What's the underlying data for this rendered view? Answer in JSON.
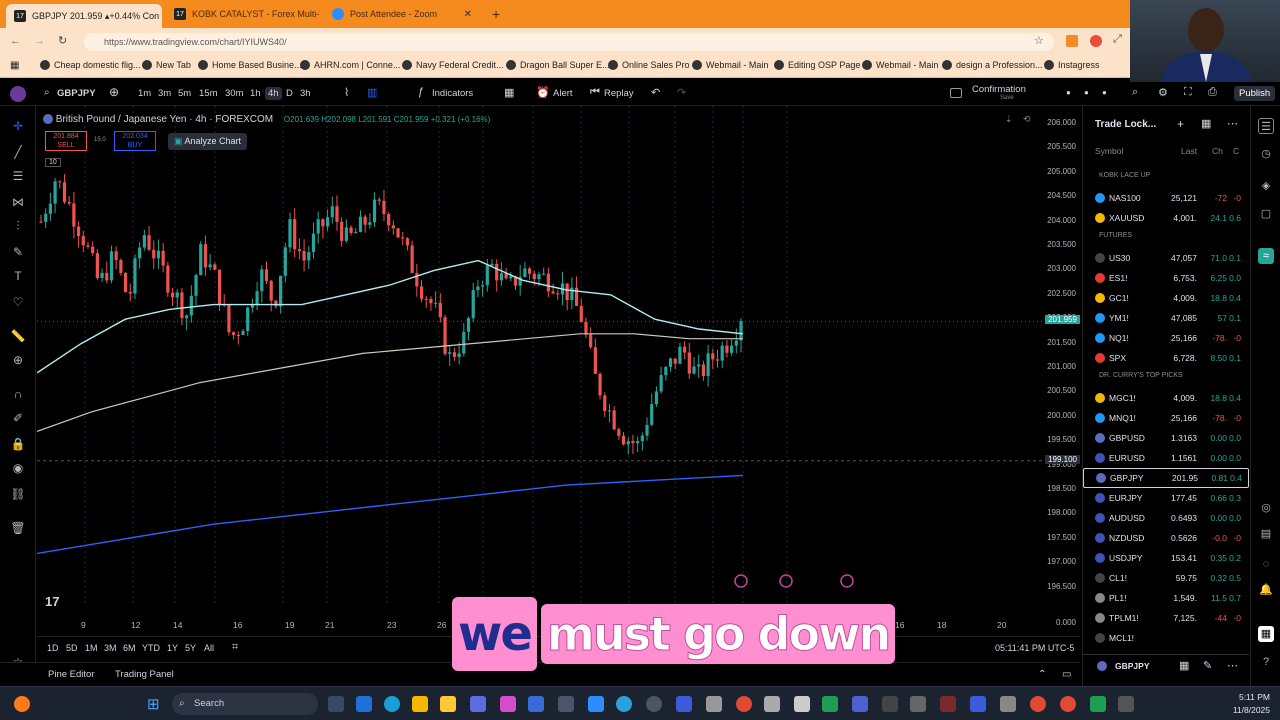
{
  "browser": {
    "tabs": [
      {
        "label": "GBPJPY 201.959 ▴+0.44% Con"
      },
      {
        "label": "KOBK CATALYST - Forex Multi-T"
      },
      {
        "label": "Post Attendee - Zoom"
      }
    ],
    "url": "https://www.tradingview.com/chart/IYIUWS40/",
    "bookmarks": [
      "Cheap domestic flig...",
      "New Tab",
      "Home Based Busine...",
      "AHRN.com | Conne...",
      "Navy Federal Credit...",
      "Dragon Ball Super E...",
      "Online Sales Pro",
      "Webmail - Main",
      "Editing OSP Page",
      "Webmail - Main",
      "design a Profession...",
      "Instagress"
    ]
  },
  "toolbar": {
    "symbol": "GBPJPY",
    "intervals": [
      "1m",
      "3m",
      "5m",
      "15m",
      "30m",
      "1h",
      "4h",
      "D",
      "3h"
    ],
    "indicators": "Indicators",
    "alert": "Alert",
    "replay": "Replay",
    "layout_name": "Confirmation",
    "layout_sub": "Save",
    "publish": "Publish"
  },
  "chart_header": {
    "title": "British Pound / Japanese Yen · 4h · FOREXCOM",
    "ohlc": "O201.639 H202.098 L201.591 C201.959 +0.321 (+0.16%)",
    "sell_price": "201.884",
    "sell_label": "SELL",
    "spread": "15.0",
    "buy_price": "202.034",
    "buy_label": "BUY",
    "analyze": "Analyze Chart",
    "vol_badge": "10"
  },
  "chart_data": {
    "type": "candlestick",
    "symbol": "GBPJPY",
    "timeframe": "4h",
    "ylim": [
      196.0,
      206.0
    ],
    "y_ticks": [
      "206.000",
      "205.500",
      "205.000",
      "204.500",
      "204.000",
      "203.500",
      "203.000",
      "202.500",
      "202.000",
      "201.500",
      "201.000",
      "200.500",
      "200.000",
      "199.500",
      "199.000",
      "198.500",
      "198.000",
      "197.500",
      "197.000",
      "196.500",
      "0.000"
    ],
    "x_ticks": [
      "9",
      "12",
      "14",
      "16",
      "19",
      "21",
      "23",
      "26",
      "M",
      "13",
      "16",
      "18",
      "20"
    ],
    "last_price": "201.959",
    "crosshair_price": "199.100",
    "close_path": [
      204.0,
      204.9,
      204.3,
      203.6,
      202.7,
      203.3,
      202.4,
      203.8,
      203.2,
      202.6,
      202.1,
      203.4,
      202.8,
      201.6,
      202.0,
      203.0,
      202.3,
      203.9,
      203.2,
      203.8,
      204.2,
      203.6,
      203.9,
      204.3,
      204.1,
      203.4,
      202.7,
      202.2,
      201.2,
      201.6,
      202.8,
      203.1,
      202.6,
      203.0,
      202.9,
      202.8,
      202.6,
      202.1,
      200.8,
      200.1,
      199.6,
      199.4,
      200.4,
      201.0,
      201.4,
      200.8,
      201.2,
      201.5,
      201.96
    ],
    "ma_fast": [
      200.9,
      201.5,
      202.0,
      202.2,
      202.3,
      202.3,
      202.3,
      202.5,
      202.7,
      203.0,
      203.2,
      202.8,
      202.6,
      202.5,
      202.0,
      201.8,
      201.7
    ],
    "ma_slow": [
      199.7,
      200.1,
      200.4,
      200.7,
      200.9,
      201.1,
      201.3,
      201.4,
      201.5,
      201.6,
      201.7,
      201.7,
      201.6,
      201.6
    ],
    "ma_long": [
      197.2,
      197.5,
      197.8,
      198.0,
      198.2,
      198.4,
      198.6,
      198.7,
      198.8
    ]
  },
  "bottombar": {
    "ranges": [
      "1D",
      "5D",
      "1M",
      "3M",
      "6M",
      "YTD",
      "1Y",
      "5Y",
      "All"
    ],
    "clock": "05:11:41 PM UTC-5"
  },
  "footer": {
    "pine": "Pine Editor",
    "trading": "Trading Panel"
  },
  "watchlist": {
    "title": "Trade Lock...",
    "headers": [
      "Symbol",
      "Last",
      "Ch",
      "C"
    ],
    "sections": [
      {
        "name": "KOBK LACE UP",
        "rows": [
          {
            "sym": "NAS100",
            "last": "25,121",
            "chg": "-72",
            "pct": "-0",
            "color": "#2196f3"
          },
          {
            "sym": "XAUUSD",
            "last": "4,001.",
            "chg": "24.1",
            "pct": "0.6",
            "color": "#f5b800"
          }
        ]
      },
      {
        "name": "FUTURES",
        "rows": [
          {
            "sym": "US30",
            "last": "47,057",
            "chg": "71.0",
            "pct": "0.1",
            "color": "#444"
          },
          {
            "sym": "ES1!",
            "last": "6,753.",
            "chg": "6.25",
            "pct": "0.0",
            "color": "#e53935"
          },
          {
            "sym": "GC1!",
            "last": "4,009.",
            "chg": "18.8",
            "pct": "0.4",
            "color": "#f5b800"
          },
          {
            "sym": "YM1!",
            "last": "47,085",
            "chg": "57",
            "pct": "0.1",
            "color": "#2196f3"
          },
          {
            "sym": "NQ1!",
            "last": "25,166",
            "chg": "-78.",
            "pct": "-0",
            "color": "#2196f3"
          },
          {
            "sym": "SPX",
            "last": "6,728.",
            "chg": "8.50",
            "pct": "0.1",
            "color": "#e53935"
          }
        ]
      },
      {
        "name": "DR. CURRY'S TOP PICKS",
        "rows": [
          {
            "sym": "MGC1!",
            "last": "4,009.",
            "chg": "18.8",
            "pct": "0.4",
            "color": "#f5b800"
          },
          {
            "sym": "MNQ1!",
            "last": "25,166",
            "chg": "-78.",
            "pct": "-0",
            "color": "#2196f3"
          },
          {
            "sym": "GBPUSD",
            "last": "1.3163",
            "chg": "0.00",
            "pct": "0.0",
            "color": "#5c6bc0"
          },
          {
            "sym": "EURUSD",
            "last": "1.1561",
            "chg": "0.00",
            "pct": "0.0",
            "color": "#3f51b5"
          },
          {
            "sym": "GBPJPY",
            "last": "201.95",
            "chg": "0.81",
            "pct": "0.4",
            "color": "#5c6bc0"
          },
          {
            "sym": "EURJPY",
            "last": "177.45",
            "chg": "0.66",
            "pct": "0.3",
            "color": "#3f51b5"
          },
          {
            "sym": "AUDUSD",
            "last": "0.6493",
            "chg": "0.00",
            "pct": "0.0",
            "color": "#3f51b5"
          },
          {
            "sym": "NZDUSD",
            "last": "0.5626",
            "chg": "-0.0",
            "pct": "-0",
            "color": "#3f51b5"
          },
          {
            "sym": "USDJPY",
            "last": "153.41",
            "chg": "0.35",
            "pct": "0.2",
            "color": "#3f51b5"
          },
          {
            "sym": "CL1!",
            "last": "59.75",
            "chg": "0.32",
            "pct": "0.5",
            "color": "#444"
          },
          {
            "sym": "PL1!",
            "last": "1,549.",
            "chg": "11.5",
            "pct": "0.7",
            "color": "#888"
          },
          {
            "sym": "TPLM1!",
            "last": "7,125.",
            "chg": "-44",
            "pct": "-0",
            "color": "#888"
          },
          {
            "sym": "MCL1!",
            "last": "",
            "chg": "",
            "pct": "",
            "color": "#444"
          }
        ]
      }
    ],
    "detail_symbol": "GBPJPY"
  },
  "taskbar": {
    "search": "Search",
    "time": "5:11 PM",
    "date": "11/8/2025"
  },
  "caption": {
    "word1": "we",
    "rest": "must go down"
  },
  "colors": {
    "up": "#26a69a",
    "down": "#ef5350",
    "ma_fast": "#b2ebf2",
    "ma_slow": "#cfc8b8",
    "ma_long": "#2962ff",
    "accent": "#f58a1f"
  }
}
